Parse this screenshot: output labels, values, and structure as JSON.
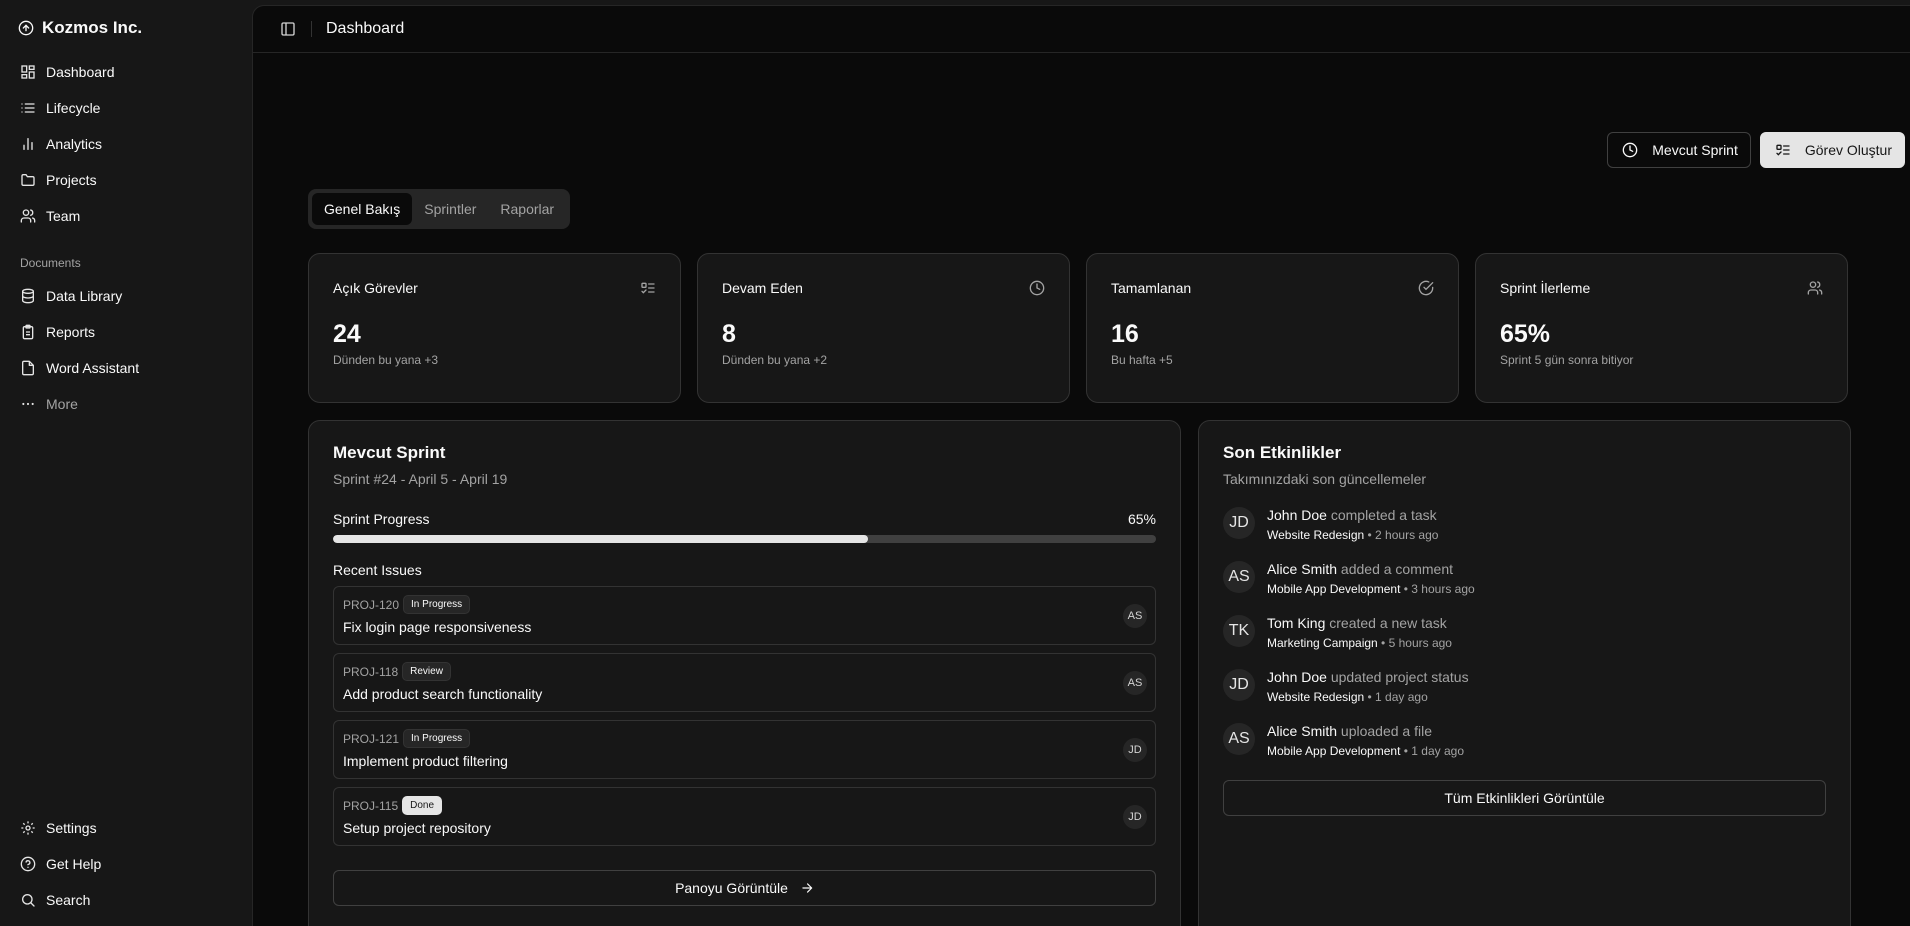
{
  "brand": {
    "name": "Kozmos Inc.",
    "icon": "circle-arrow-up-icon"
  },
  "sidebar": {
    "main_items": [
      {
        "label": "Dashboard",
        "icon": "dashboard-icon"
      },
      {
        "label": "Lifecycle",
        "icon": "list-icon"
      },
      {
        "label": "Analytics",
        "icon": "bar-chart-icon"
      },
      {
        "label": "Projects",
        "icon": "folder-icon"
      },
      {
        "label": "Team",
        "icon": "users-icon"
      }
    ],
    "documents_label": "Documents",
    "doc_items": [
      {
        "label": "Data Library",
        "icon": "database-icon"
      },
      {
        "label": "Reports",
        "icon": "clipboard-icon"
      },
      {
        "label": "Word Assistant",
        "icon": "file-icon"
      },
      {
        "label": "More",
        "icon": "ellipsis-icon"
      }
    ],
    "bottom_items": [
      {
        "label": "Settings",
        "icon": "gear-icon"
      },
      {
        "label": "Get Help",
        "icon": "help-icon"
      },
      {
        "label": "Search",
        "icon": "search-icon"
      }
    ]
  },
  "topbar": {
    "title": "Dashboard"
  },
  "actions": {
    "current_sprint": "Mevcut Sprint",
    "create_task": "Görev Oluştur"
  },
  "tabs": [
    {
      "label": "Genel Bakış",
      "active": true
    },
    {
      "label": "Sprintler",
      "active": false
    },
    {
      "label": "Raporlar",
      "active": false
    }
  ],
  "stats": [
    {
      "label": "Açık Görevler",
      "value": "24",
      "sub": "Dünden bu yana +3",
      "icon": "list-todo-icon"
    },
    {
      "label": "Devam Eden",
      "value": "8",
      "sub": "Dünden bu yana +2",
      "icon": "clock-icon"
    },
    {
      "label": "Tamamlanan",
      "value": "16",
      "sub": "Bu hafta +5",
      "icon": "check-circle-icon"
    },
    {
      "label": "Sprint İlerleme",
      "value": "65%",
      "sub": "Sprint 5 gün sonra bitiyor",
      "icon": "users-icon"
    }
  ],
  "sprint": {
    "title": "Mevcut Sprint",
    "subtitle": "Sprint #24 - April 5 - April 19",
    "progress_label": "Sprint Progress",
    "progress_text": "65%",
    "progress_value": 0.65,
    "issues_title": "Recent Issues",
    "issues": [
      {
        "id": "PROJ-120",
        "status": "In Progress",
        "title": "Fix login page responsiveness",
        "assignee": "AS"
      },
      {
        "id": "PROJ-118",
        "status": "Review",
        "title": "Add product search functionality",
        "assignee": "AS"
      },
      {
        "id": "PROJ-121",
        "status": "In Progress",
        "title": "Implement product filtering",
        "assignee": "JD"
      },
      {
        "id": "PROJ-115",
        "status": "Done",
        "title": "Setup project repository",
        "assignee": "JD"
      }
    ],
    "board_button": "Panoyu Görüntüle"
  },
  "activity": {
    "title": "Son Etkinlikler",
    "subtitle": "Takımınızdaki son güncellemeler",
    "items": [
      {
        "initials": "JD",
        "who": "John Doe",
        "action": "completed a task",
        "project": "Website Redesign",
        "time": "2 hours ago"
      },
      {
        "initials": "AS",
        "who": "Alice Smith",
        "action": "added a comment",
        "project": "Mobile App Development",
        "time": "3 hours ago"
      },
      {
        "initials": "TK",
        "who": "Tom King",
        "action": "created a new task",
        "project": "Marketing Campaign",
        "time": "5 hours ago"
      },
      {
        "initials": "JD",
        "who": "John Doe",
        "action": "updated project status",
        "project": "Website Redesign",
        "time": "1 day ago"
      },
      {
        "initials": "AS",
        "who": "Alice Smith",
        "action": "uploaded a file",
        "project": "Mobile App Development",
        "time": "1 day ago"
      }
    ],
    "view_all": "Tüm Etkinlikleri Görüntüle"
  }
}
